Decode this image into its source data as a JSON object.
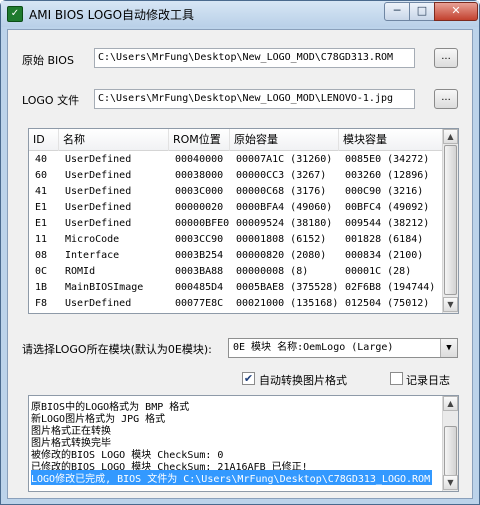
{
  "window": {
    "title": "AMI BIOS LOGO自动修改工具",
    "minimize_glyph": "─",
    "maximize_glyph": "□",
    "close_glyph": "✕"
  },
  "original_bios": {
    "label": "原始 BIOS",
    "path": "C:\\Users\\MrFung\\Desktop\\New_LOGO_MOD\\C78GD313.ROM",
    "browse_label": "..."
  },
  "logo_file": {
    "label": "LOGO 文件",
    "path": "C:\\Users\\MrFung\\Desktop\\New_LOGO_MOD\\LENOVO-1.jpg",
    "browse_label": "..."
  },
  "module_table": {
    "columns": [
      "ID",
      "名称",
      "ROM位置",
      "原始容量",
      "模块容量"
    ],
    "rows": [
      [
        "40",
        "UserDefined",
        "00040000",
        "00007A1C (31260)",
        "0085E0 (34272)"
      ],
      [
        "60",
        "UserDefined",
        "00038000",
        "00000CC3 (3267)",
        "003260 (12896)"
      ],
      [
        "41",
        "UserDefined",
        "0003C000",
        "00000C68 (3176)",
        "000C90 (3216)"
      ],
      [
        "E1",
        "UserDefined",
        "00000020",
        "0000BFA4 (49060)",
        "00BFC4 (49092)"
      ],
      [
        "E1",
        "UserDefined",
        "00000BFE0",
        "00009524 (38180)",
        "009544 (38212)"
      ],
      [
        "11",
        "MicroCode",
        "0003CC90",
        "00001808 (6152)",
        "001828 (6184)"
      ],
      [
        "08",
        "Interface",
        "0003B254",
        "00000820 (2080)",
        "000834 (2100)"
      ],
      [
        "0C",
        "ROMId",
        "0003BA88",
        "00000008 (8)",
        "00001C (28)"
      ],
      [
        "1B",
        "MainBIOSImage",
        "000485D4",
        "0005BAE8 (375528)",
        "02F6B8 (194744)"
      ],
      [
        "F8",
        "UserDefined",
        "00077E8C",
        "00021000 (135168)",
        "012504 (75012)"
      ]
    ]
  },
  "module_select": {
    "label": "请选择LOGO所在模块(默认为0E模块):",
    "selected": "0E 模块  名称:OemLogo (Large)"
  },
  "options": {
    "auto_convert_label": "自动转换图片格式",
    "auto_convert_checked": true,
    "check_mark": "✔",
    "log_label": "记录日志",
    "log_checked": false
  },
  "log": {
    "lines": [
      "原BIOS中的LOGO格式为 BMP 格式",
      "新LOGO图片格式为 JPG 格式",
      "图片格式正在转换",
      "图片格式转换完毕",
      "被修改的BIOS LOGO 模块 CheckSum: 0",
      "已修改的BIOS LOGO 模块 CheckSum: 21A16AFB  已修正!",
      "LOGO修改已完成, BIOS 文件为 C:\\Users\\MrFung\\Desktop\\C78GD313_LOGO.ROM"
    ],
    "selected_line_index": 6
  },
  "scroll_glyphs": {
    "up": "▲",
    "down": "▼"
  }
}
